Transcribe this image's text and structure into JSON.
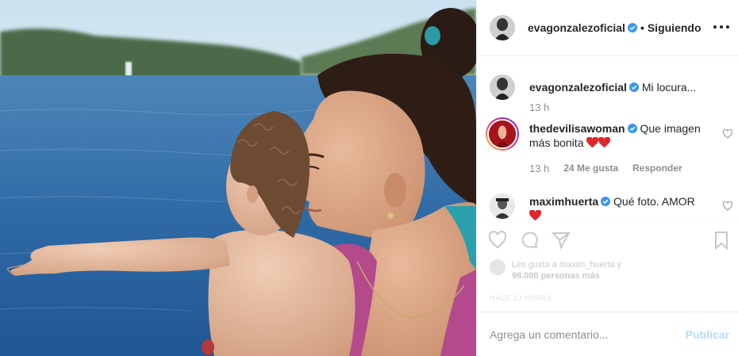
{
  "post": {
    "author": "evagonzalezoficial",
    "separator": "•",
    "follow_label": "Siguiendo",
    "more_icon": "more-options-icon"
  },
  "caption": {
    "username": "evagonzalezoficial",
    "text": "Mi locura...",
    "time": "13 h"
  },
  "comments": [
    {
      "username": "thedevilisawoman",
      "text": "Que imagen más bonita",
      "emoji": [
        "heart",
        "heart"
      ],
      "time": "13 h",
      "likes": "24 Me gusta",
      "reply_label": "Responder"
    },
    {
      "username": "maximhuerta",
      "text": "Qué foto. AMOR",
      "emoji": [
        "heart"
      ]
    }
  ],
  "likes_summary": {
    "line1": "Les gusta a maxim_huerta y",
    "line2": "98.000 personas más"
  },
  "post_age": "HACE 13 HORAS",
  "comment_box": {
    "placeholder": "Agrega un comentario...",
    "publish_label": "Publicar"
  },
  "colors": {
    "verified": "#3897f0",
    "heart": "#e0252b",
    "muted": "#8e8e8e",
    "publish_disabled": "#b3dbff"
  }
}
